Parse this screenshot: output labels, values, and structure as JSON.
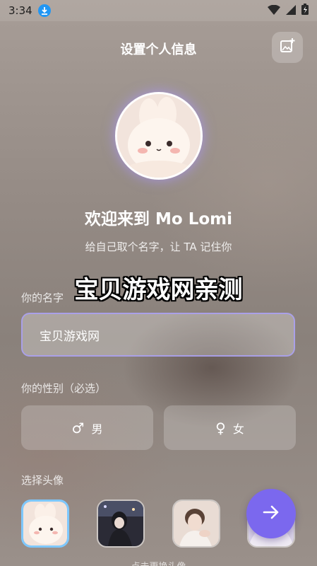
{
  "status_bar": {
    "time": "3:34"
  },
  "header": {
    "title": "设置个人信息"
  },
  "welcome": {
    "title": "欢迎来到 Mo Lomi",
    "subtitle": "给自己取个名字，让 TA 记住你"
  },
  "watermark": "宝贝游戏网亲测",
  "name_field": {
    "label": "你的名字",
    "value": "宝贝游戏网"
  },
  "gender": {
    "label": "你的性别（必选）",
    "male": {
      "symbol": "♂",
      "label": "男"
    },
    "female": {
      "symbol": "♀",
      "label": "女"
    }
  },
  "avatar_picker": {
    "label": "选择头像",
    "hint": "点击更换头像",
    "options": [
      "bunny-plush",
      "girl-portrait",
      "boy-portrait",
      "partial-portrait"
    ],
    "selected": 0
  },
  "colors": {
    "accent": "#7b68ee",
    "selected_border": "#7ec8ff"
  }
}
